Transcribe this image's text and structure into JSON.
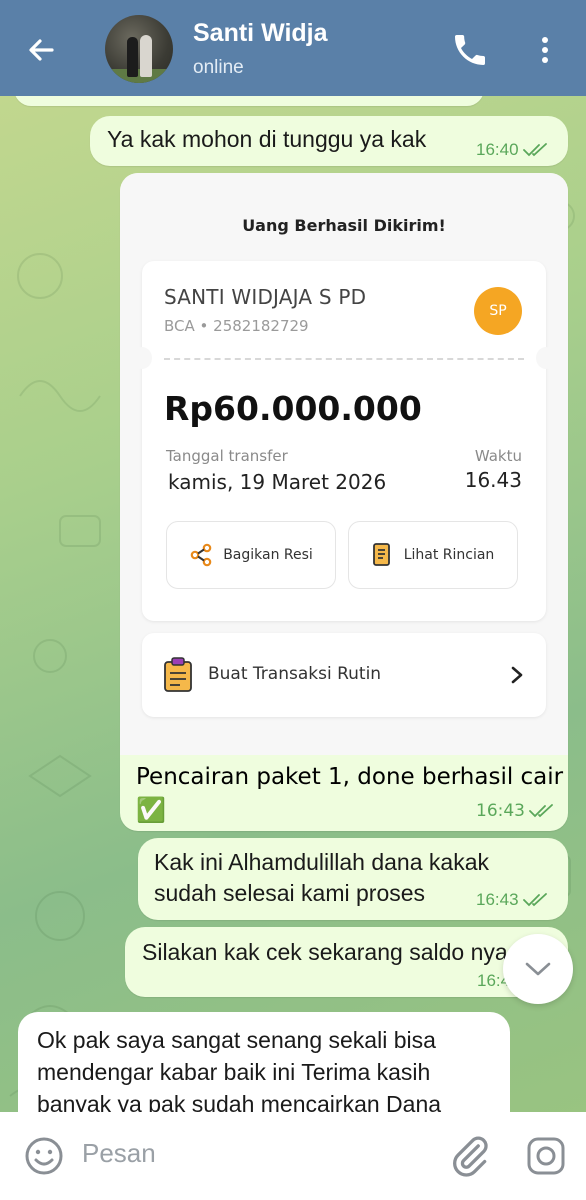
{
  "header": {
    "title": "Santi Widja",
    "status": "online"
  },
  "messages": [
    {
      "text": "Ya kak mohon di tunggu ya kak",
      "time": "16:40"
    },
    {
      "text": "Pencairan paket 1, done berhasil cair",
      "emoji": "✅",
      "time": "16:43"
    },
    {
      "text_line1": "Kak ini Alhamdulillah dana kakak",
      "text_line2": "sudah selesai kami proses",
      "time": "16:43"
    },
    {
      "text": "Silakan kak cek sekarang saldo nya",
      "time": "16:43"
    },
    {
      "text_line1": "Ok pak saya sangat senang sekali bisa",
      "text_line2": "mendengar kabar baik ini Terima kasih",
      "text_line3": "banyak ya pak sudah mencairkan Dana"
    }
  ],
  "receipt": {
    "title": "Uang Berhasil Dikirim!",
    "recipient_name": "SANTI WIDJAJA S PD",
    "account": "BCA • 2582182729",
    "initials": "SP",
    "amount": "Rp60.000.000",
    "date_label": "Tanggal transfer",
    "date": "kamis, 19 Maret 2026",
    "time_label": "Waktu",
    "time": "16.43",
    "share_label": "Bagikan Resi",
    "detail_label": "Lihat Rincian",
    "routine_label": "Buat Transaksi Rutin"
  },
  "input": {
    "placeholder": "Pesan"
  },
  "colors": {
    "header": "#5a80a8",
    "bubble_out": "#effdde",
    "time_green": "#5aa75a",
    "avatar_badge": "#f5a623"
  }
}
